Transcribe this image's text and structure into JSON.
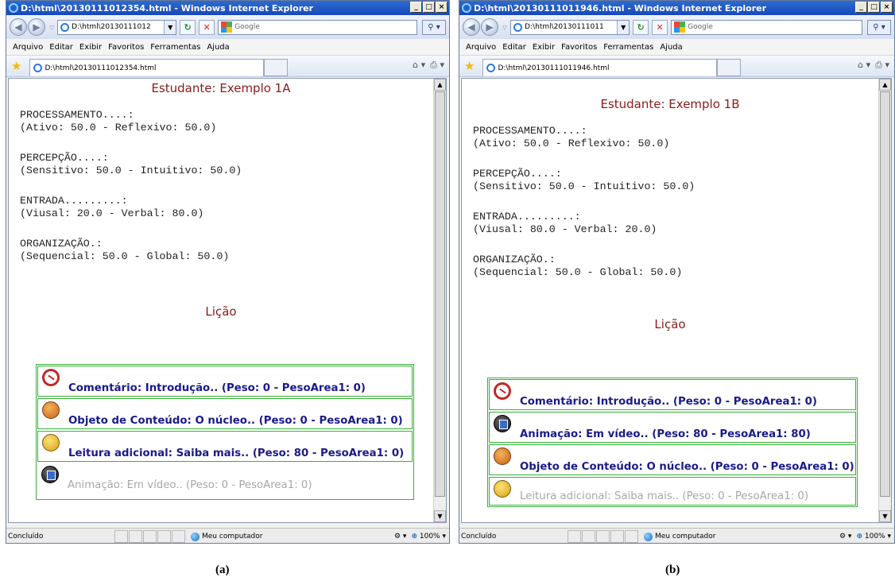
{
  "windows": [
    {
      "title": "D:\\html\\20130111012354.html - Windows Internet Explorer",
      "address": "D:\\html\\20130111012",
      "search_placeholder": "Google",
      "menu": [
        "Arquivo",
        "Editar",
        "Exibir",
        "Favoritos",
        "Ferramentas",
        "Ajuda"
      ],
      "tab_title": "D:\\html\\20130111012354.html",
      "student": "Estudante: Exemplo 1A",
      "dimensions": [
        {
          "label": "PROCESSAMENTO....:",
          "values": "(Ativo: 50.0 - Reflexivo: 50.0)"
        },
        {
          "label": "PERCEPÇÃO....:",
          "values": "(Sensitivo: 50.0 - Intuitivo: 50.0)"
        },
        {
          "label": "ENTRADA.........:",
          "values": "(Viusal: 20.0 - Verbal: 80.0)"
        },
        {
          "label": "ORGANIZAÇÃO.:",
          "values": "(Sequencial: 50.0 - Global: 50.0)"
        }
      ],
      "lesson_heading": "Lição",
      "lessons": [
        {
          "icon": "comment-icon",
          "text": "Comentário: Introdução.. (Peso: 0 - PesoArea1: 0)",
          "enabled": true
        },
        {
          "icon": "object-icon",
          "text": "Objeto de Conteúdo: O núcleo.. (Peso: 0 - PesoArea1: 0)",
          "enabled": true
        },
        {
          "icon": "reading-icon",
          "text": "Leitura adicional: Saiba mais.. (Peso: 80 - PesoArea1: 0)",
          "enabled": true
        },
        {
          "icon": "video-icon",
          "text": "Animação: Em vídeo.. (Peso: 0 - PesoArea1: 0)",
          "enabled": false
        }
      ],
      "status": "Concluído",
      "zone": "Meu computador",
      "zoom": "100%"
    },
    {
      "title": "D:\\html\\20130111011946.html - Windows Internet Explorer",
      "address": "D:\\html\\20130111011",
      "search_placeholder": "Google",
      "menu": [
        "Arquivo",
        "Editar",
        "Exibir",
        "Favoritos",
        "Ferramentas",
        "Ajuda"
      ],
      "tab_title": "D:\\html\\20130111011946.html",
      "student": "Estudante: Exemplo 1B",
      "dimensions": [
        {
          "label": "PROCESSAMENTO....:",
          "values": "(Ativo: 50.0 - Reflexivo: 50.0)"
        },
        {
          "label": "PERCEPÇÃO....:",
          "values": "(Sensitivo: 50.0 - Intuitivo: 50.0)"
        },
        {
          "label": "ENTRADA.........:",
          "values": "(Viusal: 80.0 - Verbal: 20.0)"
        },
        {
          "label": "ORGANIZAÇÃO.:",
          "values": "(Sequencial: 50.0 - Global: 50.0)"
        }
      ],
      "lesson_heading": "Lição",
      "lessons": [
        {
          "icon": "comment-icon",
          "text": "Comentário: Introdução.. (Peso: 0 - PesoArea1: 0)",
          "enabled": true
        },
        {
          "icon": "video-icon",
          "text": "Animação: Em vídeo.. (Peso: 80 - PesoArea1: 80)",
          "enabled": true
        },
        {
          "icon": "object-icon",
          "text": "Objeto de Conteúdo: O núcleo.. (Peso: 0 - PesoArea1: 0)",
          "enabled": true
        },
        {
          "icon": "reading-icon",
          "text": "Leitura adicional: Saiba mais.. (Peso: 0 - PesoArea1: 0)",
          "enabled": false
        }
      ],
      "status": "Concluído",
      "zone": "Meu computador",
      "zoom": "100%"
    }
  ],
  "captions": [
    "(a)",
    "(b)"
  ]
}
